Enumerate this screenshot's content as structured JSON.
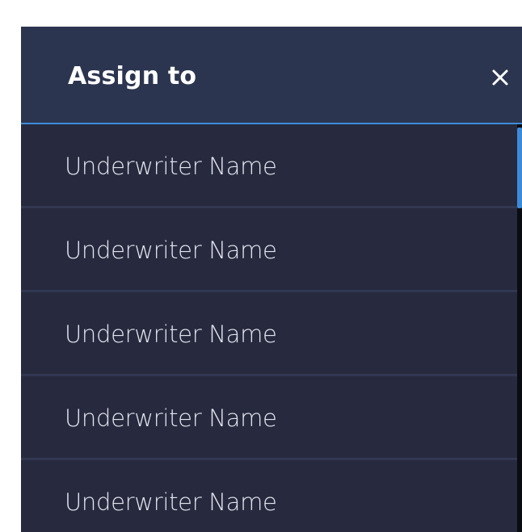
{
  "dialog": {
    "title": "Assign to",
    "close_icon": "close-icon"
  },
  "underwriters": [
    {
      "label": "Underwriter Name"
    },
    {
      "label": "Underwriter Name"
    },
    {
      "label": "Underwriter Name"
    },
    {
      "label": "Underwriter Name"
    },
    {
      "label": "Underwriter Name"
    }
  ],
  "colors": {
    "header_bg": "#2c3550",
    "list_bg": "#272a3e",
    "accent": "#3d8bd8",
    "divider": "#323752",
    "text": "#e3e5ee"
  }
}
